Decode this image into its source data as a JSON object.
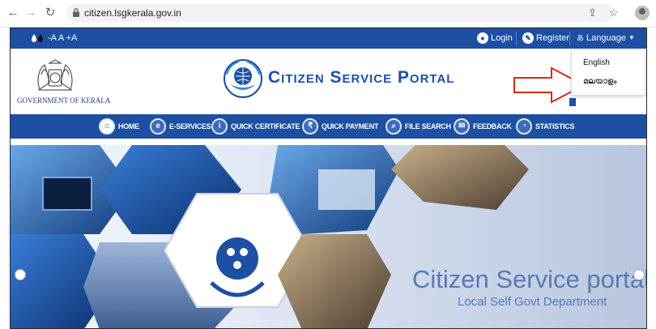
{
  "browser": {
    "url": "citizen.lsgkerala.gov.in",
    "back_icon": "arrow-left-icon",
    "forward_icon": "arrow-right-icon",
    "reload_icon": "reload-icon",
    "share_icon": "share-icon",
    "star_icon": "star-icon",
    "profile_icon": "profile-icon"
  },
  "topbar": {
    "font_controls": "-A A +A",
    "login_label": "Login",
    "register_label": "Register",
    "language_label": "Language",
    "bg_color": "#1d4fa3"
  },
  "header": {
    "government_label": "GOVERNMENT OF KERALA",
    "portal_title": "Citizen Service Portal",
    "accent_color": "#1d4fa3"
  },
  "language_menu": {
    "options": [
      "English",
      "മലയാളം"
    ]
  },
  "main_nav": {
    "items": [
      {
        "label": "HOME",
        "icon": "home-icon"
      },
      {
        "label": "E-SERVICES",
        "icon": "e-services-icon"
      },
      {
        "label": "QUICK CERTIFICATE",
        "icon": "info-icon"
      },
      {
        "label": "QUICK PAYMENT",
        "icon": "rupee-icon"
      },
      {
        "label": "FILE SEARCH",
        "icon": "search-icon"
      },
      {
        "label": "FEEDBACK",
        "icon": "feedback-icon"
      },
      {
        "label": "STATISTICS",
        "icon": "statistics-icon"
      }
    ]
  },
  "banner": {
    "title": "Citizen Service portal",
    "subtitle": "Local Self Govt Department"
  }
}
